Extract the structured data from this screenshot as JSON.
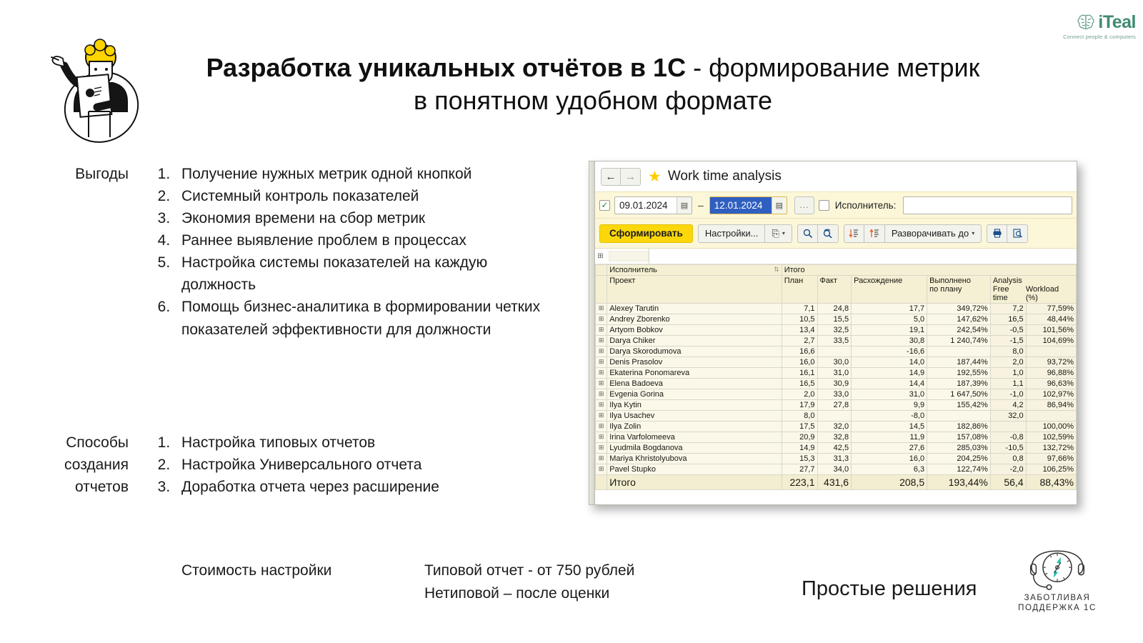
{
  "brand": {
    "logo_name": "iTeal",
    "logo_tagline": "Connect people & computers",
    "logo_color": "#3f8a72"
  },
  "title": {
    "strong": "Разработка уникальных отчётов в 1С",
    "rest": " - формирование метрик",
    "line2": "в понятном удобном формате"
  },
  "sections": {
    "benefits_label": "Выгоды",
    "benefits": [
      "Получение нужных метрик одной кнопкой",
      "Системный контроль показателей",
      "Экономия времени на сбор метрик",
      "Раннее выявление проблем в процессах",
      "Настройка системы показателей на каждую должность",
      "Помощь бизнес-аналитика в формировании четких показателей эффективности для должности"
    ],
    "methods_label": "Способы создания отчетов",
    "methods": [
      "Настройка типовых отчетов",
      "Настройка Универсального отчета",
      "Доработка отчета через расширение"
    ]
  },
  "footer": {
    "cost_label": "Стоимость настройки",
    "price_line1": "Типовой отчет -  от 750 рублей",
    "price_line2": "Нетиповой – после оценки",
    "slogan": "Простые решения",
    "support_line1": "ЗАБОТЛИВАЯ",
    "support_line2": "ПОДДЕРЖКА 1С"
  },
  "app": {
    "window_title": "Work time analysis",
    "nav_back": "←",
    "nav_forward": "→",
    "star": "★",
    "date_from": "09.01.2024",
    "date_to": "12.01.2024",
    "date_separator": "–",
    "ellipsis_button": "...",
    "executor_label": "Исполнитель:",
    "executor_value": "",
    "toolbar": {
      "generate": "Сформировать",
      "settings": "Настройки...",
      "copy_icon": "⎘",
      "caret": "▾",
      "search_icon": "🔍",
      "search_again_icon": "⟳",
      "sort_desc_icon": "↓≣",
      "sort_asc_icon": "↑≣",
      "expand_to": "Разворачивать до",
      "print_icon": "🖶",
      "preview_icon": "🔍"
    },
    "table": {
      "header": {
        "executor": "Исполнитель",
        "total_group": "Итого",
        "project": "Проект",
        "plan": "План",
        "fact": "Факт",
        "variance": "Расхождение",
        "done_by_plan_l1": "Выполнено",
        "done_by_plan_l2": "по плану",
        "analysis": "Analysis",
        "free_time_l1": "Free",
        "free_time_l2": "time",
        "workload_l1": "Workload",
        "workload_l2": "(%)"
      },
      "rows": [
        {
          "name": "Alexey Tarutin",
          "plan": "7,1",
          "fact": "24,8",
          "variance": "17,7",
          "done": "349,72%",
          "free": "7,2",
          "workload": "77,59%"
        },
        {
          "name": "Andrey Zborenko",
          "plan": "10,5",
          "fact": "15,5",
          "variance": "5,0",
          "done": "147,62%",
          "free": "16,5",
          "workload": "48,44%"
        },
        {
          "name": "Artyom Bobkov",
          "plan": "13,4",
          "fact": "32,5",
          "variance": "19,1",
          "done": "242,54%",
          "free": "-0,5",
          "workload": "101,56%"
        },
        {
          "name": "Darya Chiker",
          "plan": "2,7",
          "fact": "33,5",
          "variance": "30,8",
          "done": "1 240,74%",
          "free": "-1,5",
          "workload": "104,69%"
        },
        {
          "name": "Darya Skorodumova",
          "plan": "16,6",
          "fact": "",
          "variance": "-16,6",
          "done": "",
          "free": "8,0",
          "workload": ""
        },
        {
          "name": "Denis Prasolov",
          "plan": "16,0",
          "fact": "30,0",
          "variance": "14,0",
          "done": "187,44%",
          "free": "2,0",
          "workload": "93,72%"
        },
        {
          "name": "Ekaterina Ponomareva",
          "plan": "16,1",
          "fact": "31,0",
          "variance": "14,9",
          "done": "192,55%",
          "free": "1,0",
          "workload": "96,88%"
        },
        {
          "name": "Elena Badoeva",
          "plan": "16,5",
          "fact": "30,9",
          "variance": "14,4",
          "done": "187,39%",
          "free": "1,1",
          "workload": "96,63%"
        },
        {
          "name": "Evgenia Gorina",
          "plan": "2,0",
          "fact": "33,0",
          "variance": "31,0",
          "done": "1 647,50%",
          "free": "-1,0",
          "workload": "102,97%"
        },
        {
          "name": "Ilya Kytin",
          "plan": "17,9",
          "fact": "27,8",
          "variance": "9,9",
          "done": "155,42%",
          "free": "4,2",
          "workload": "86,94%"
        },
        {
          "name": "Ilya Usachev",
          "plan": "8,0",
          "fact": "",
          "variance": "-8,0",
          "done": "",
          "free": "32,0",
          "workload": ""
        },
        {
          "name": "Ilya Zolin",
          "plan": "17,5",
          "fact": "32,0",
          "variance": "14,5",
          "done": "182,86%",
          "free": "",
          "workload": "100,00%"
        },
        {
          "name": "Irina Varfolomeeva",
          "plan": "20,9",
          "fact": "32,8",
          "variance": "11,9",
          "done": "157,08%",
          "free": "-0,8",
          "workload": "102,59%"
        },
        {
          "name": "Lyudmila Bogdanova",
          "plan": "14,9",
          "fact": "42,5",
          "variance": "27,6",
          "done": "285,03%",
          "free": "-10,5",
          "workload": "132,72%"
        },
        {
          "name": "Mariya Khristolyubova",
          "plan": "15,3",
          "fact": "31,3",
          "variance": "16,0",
          "done": "204,25%",
          "free": "0,8",
          "workload": "97,66%"
        },
        {
          "name": "Pavel Stupko",
          "plan": "27,7",
          "fact": "34,0",
          "variance": "6,3",
          "done": "122,74%",
          "free": "-2,0",
          "workload": "106,25%"
        }
      ],
      "total": {
        "name": "Итого",
        "plan": "223,1",
        "fact": "431,6",
        "variance": "208,5",
        "done": "193,44%",
        "free": "56,4",
        "workload": "88,43%"
      }
    }
  }
}
